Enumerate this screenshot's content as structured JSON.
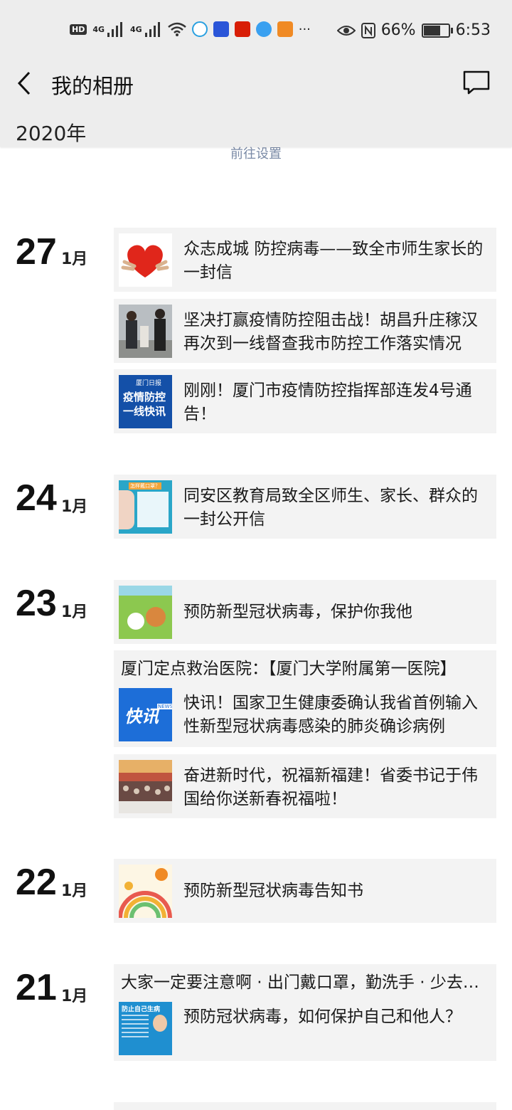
{
  "status_bar": {
    "hd": "HD",
    "net1": "4G",
    "net2": "4G",
    "battery": "66%",
    "time": "6:53",
    "more": "···"
  },
  "header": {
    "title": "我的相册"
  },
  "year": "2020年",
  "goto_settings": "前往设置",
  "groups": [
    {
      "day": "27",
      "month": "1月",
      "posts": [
        "众志成城 防控病毒——致全市师生家长的一封信",
        "坚决打赢疫情防控阻击战！胡昌升庄稼汉再次到一线督查我市防控工作落实情况",
        "刚刚！厦门市疫情防控指挥部连发4号通告！"
      ]
    },
    {
      "day": "24",
      "month": "1月",
      "posts": [
        "同安区教育局致全区师生、家长、群众的一封公开信"
      ]
    },
    {
      "day": "23",
      "month": "1月",
      "posts": [
        "预防新型冠状病毒，保护你我他",
        "快讯！国家卫生健康委确认我省首例输入性新型冠状病毒感染的肺炎确诊病例",
        "奋进新时代，祝福新福建！省委书记于伟国给你送新春祝福啦！"
      ],
      "note": "厦门定点救治医院：【厦门大学附属第一医院】"
    },
    {
      "day": "22",
      "month": "1月",
      "posts": [
        "预防新型冠状病毒告知书"
      ]
    },
    {
      "day": "21",
      "month": "1月",
      "posts": [
        "预防冠状病毒，如何保护自己和他人？"
      ],
      "note": "大家一定要注意啊 · 出门戴口罩，勤洗手 · 少去人员密集场所"
    }
  ],
  "thumb_text": {
    "t3_line1": "疫情防控",
    "t3_line2": "一线快讯",
    "t3_brand": "厦门日报",
    "t5_q": "怎样戴口罩？",
    "t7": "快讯",
    "t7_news": "NEWS",
    "t10_title": "防止自己生病"
  },
  "colors": {
    "bar_bg": "#ededed",
    "card_bg": "#f3f3f3",
    "link": "#7a8aa6"
  }
}
